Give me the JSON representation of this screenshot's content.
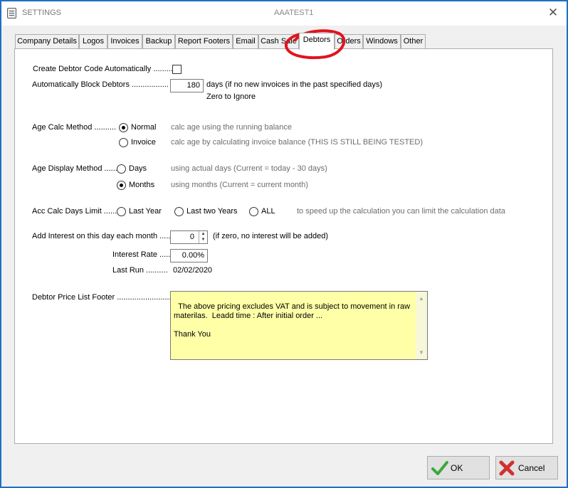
{
  "window": {
    "title": "SETTINGS",
    "center_title": "AAATEST1",
    "close_glyph": "✕"
  },
  "tabs": [
    {
      "label": "Company Details"
    },
    {
      "label": "Logos"
    },
    {
      "label": "Invoices"
    },
    {
      "label": "Backup"
    },
    {
      "label": "Report Footers"
    },
    {
      "label": "Email"
    },
    {
      "label": "Cash Sale"
    },
    {
      "label": "Debtors",
      "active": true
    },
    {
      "label": "Orders"
    },
    {
      "label": "Windows"
    },
    {
      "label": "Other"
    }
  ],
  "form": {
    "create_code_label": "Create Debtor Code Automatically .........",
    "block_label": "Automatically Block Debtors .................",
    "block_days": "180",
    "block_suffix": "days  (if no new invoices in the past specified days)",
    "block_zero": "Zero to Ignore",
    "age_calc_label": "Age Calc Method ..........",
    "age_normal": "Normal",
    "age_normal_desc": "calc age using the running balance",
    "age_invoice": "Invoice",
    "age_invoice_desc": "calc age by calculating invoice balance (THIS IS STILL BEING TESTED)",
    "age_display_label": "Age Display Method ......",
    "disp_days": "Days",
    "disp_days_desc": "using actual days (Current = today - 30 days)",
    "disp_months": "Months",
    "disp_months_desc": "using months (Current = current month)",
    "acc_calc_label": "Acc Calc Days Limit ......",
    "acc_last_year": "Last Year",
    "acc_last_two": "Last two Years",
    "acc_all": "ALL",
    "acc_desc": "to speed up the calculation you can limit the calculation data",
    "interest_label": "Add Interest on this day each month .....",
    "interest_day": "0",
    "interest_desc": "(if zero, no interest will be added)",
    "rate_label": "Interest Rate .....",
    "rate_value": "0.00%",
    "last_run_label": "Last Run ..........",
    "last_run_value": "02/02/2020",
    "footer_label": "Debtor Price List Footer ..........................",
    "footer_text": "The above pricing excludes VAT and is subject to movement in raw\nmaterilas.  Leadd time : After initial order ...\n\nThank You"
  },
  "buttons": {
    "ok": "OK",
    "cancel": "Cancel"
  },
  "colors": {
    "footer_bg": "#ffffa8",
    "ok_icon": "#3aa83a",
    "cancel_icon": "#d03030",
    "annotation": "#e0141e"
  }
}
